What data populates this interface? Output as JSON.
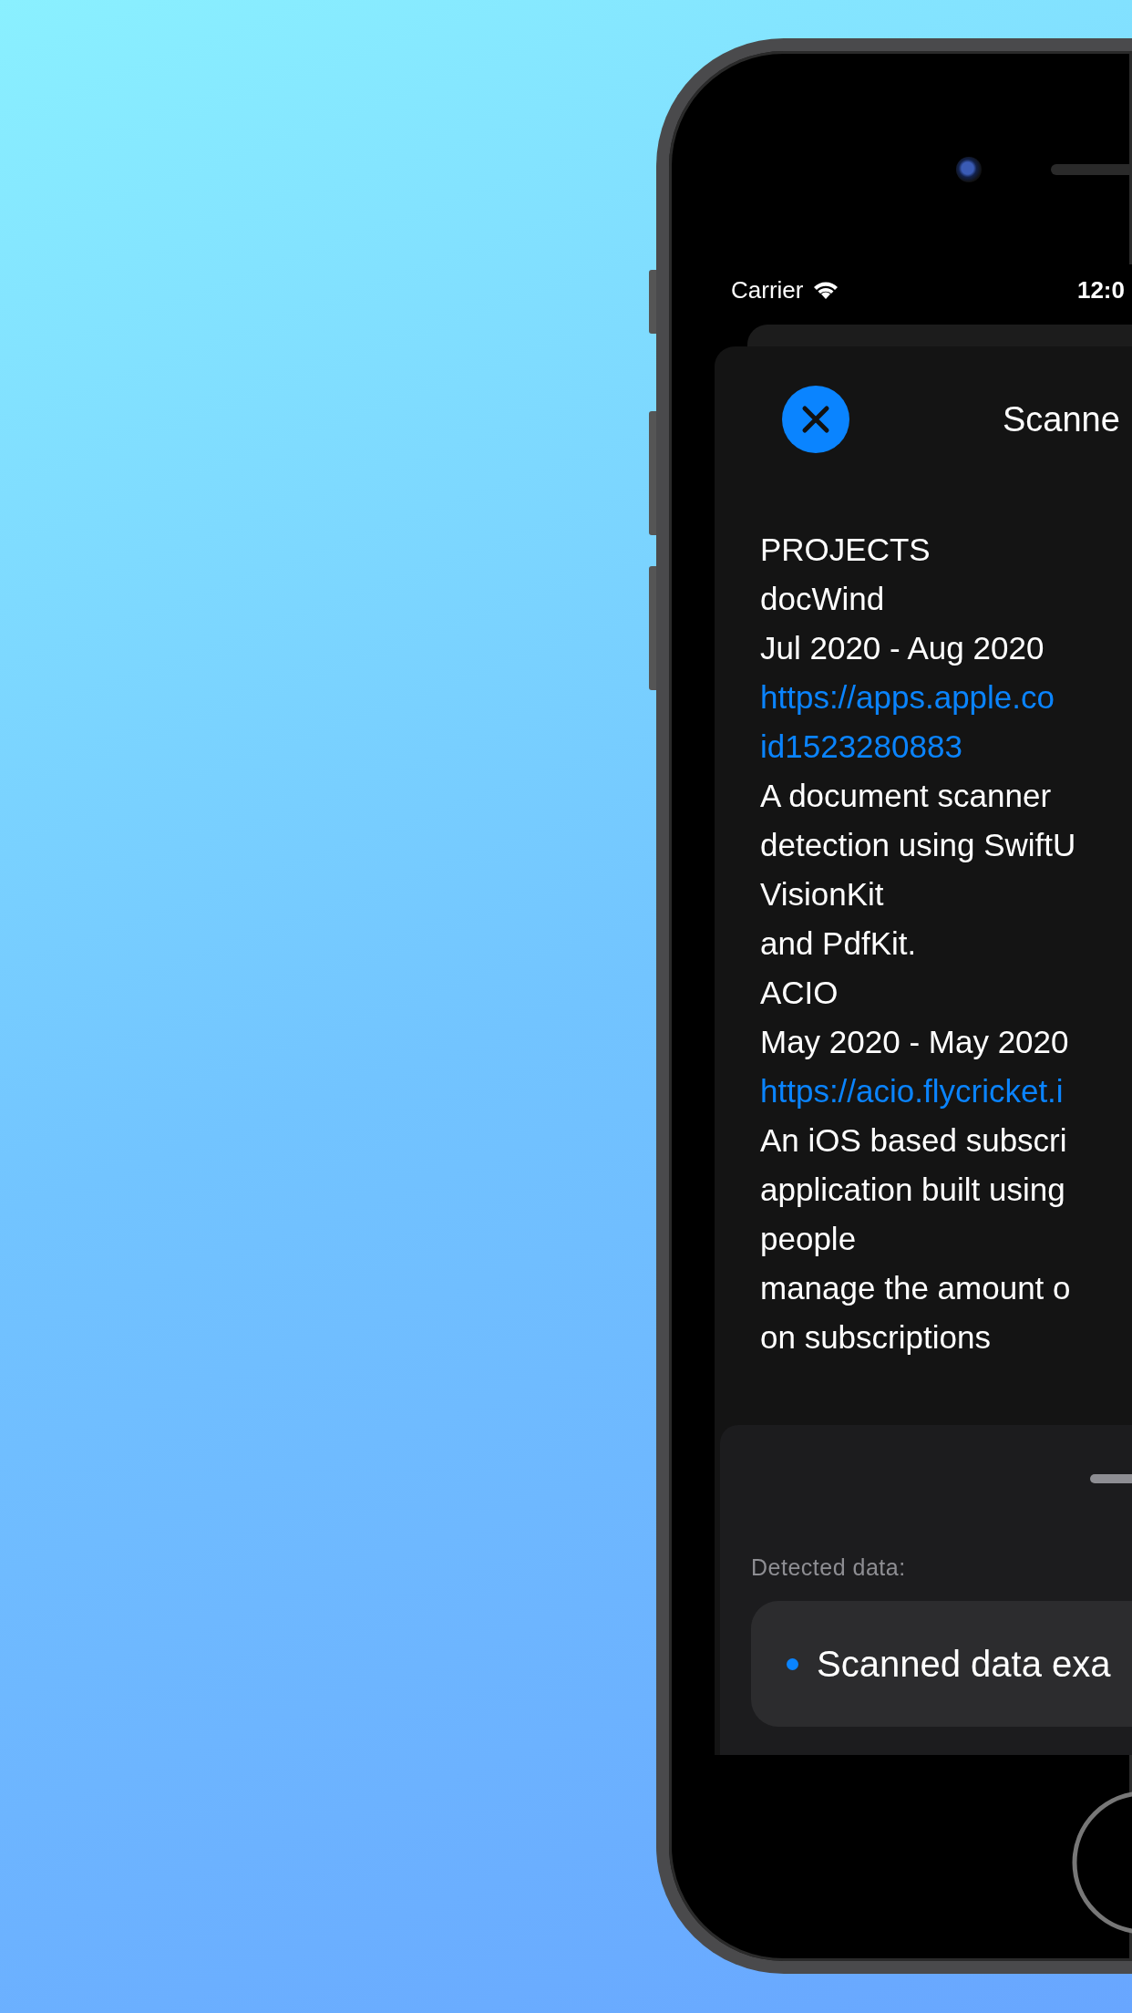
{
  "status_bar": {
    "carrier": "Carrier",
    "time": "12:0"
  },
  "sheet": {
    "title": "Scanne",
    "lines": [
      {
        "kind": "text",
        "text": "PROJECTS"
      },
      {
        "kind": "text",
        "text": "docWind"
      },
      {
        "kind": "text",
        "text": "Jul 2020 - Aug 2020"
      },
      {
        "kind": "link",
        "text": "https://apps.apple.co"
      },
      {
        "kind": "link",
        "text": "id1523280883"
      },
      {
        "kind": "text",
        "text": "A document scanner"
      },
      {
        "kind": "text",
        "text": "detection using SwiftU"
      },
      {
        "kind": "text",
        "text": "VisionKit"
      },
      {
        "kind": "text",
        "text": "and PdfKit."
      },
      {
        "kind": "text",
        "text": "ACIO"
      },
      {
        "kind": "text",
        "text": "May 2020 - May 2020"
      },
      {
        "kind": "link",
        "text": "https://acio.flycricket.i"
      },
      {
        "kind": "text",
        "text": "An iOS based subscri"
      },
      {
        "kind": "text",
        "text": "application built using"
      },
      {
        "kind": "text",
        "text": "people"
      },
      {
        "kind": "text",
        "text": "manage the amount o"
      },
      {
        "kind": "text",
        "text": "on subscriptions"
      }
    ]
  },
  "detected": {
    "label": "Detected data:",
    "items": [
      {
        "text": "Scanned data exa",
        "color": "#0a84ff"
      }
    ]
  }
}
